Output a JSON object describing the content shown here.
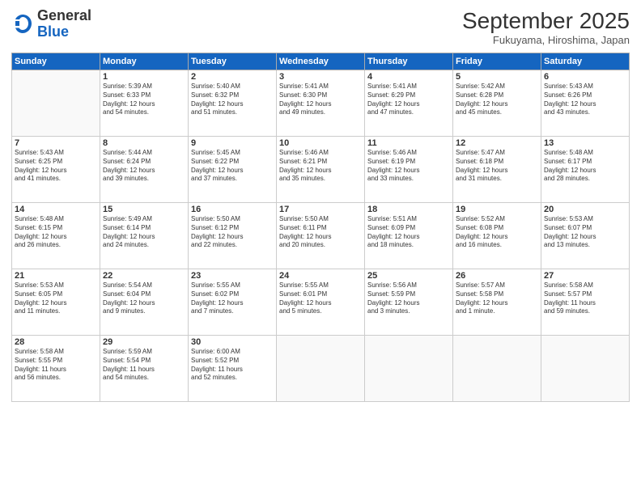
{
  "header": {
    "logo_general": "General",
    "logo_blue": "Blue",
    "month_title": "September 2025",
    "subtitle": "Fukuyama, Hiroshima, Japan"
  },
  "days_of_week": [
    "Sunday",
    "Monday",
    "Tuesday",
    "Wednesday",
    "Thursday",
    "Friday",
    "Saturday"
  ],
  "weeks": [
    [
      {
        "day": "",
        "info": ""
      },
      {
        "day": "1",
        "info": "Sunrise: 5:39 AM\nSunset: 6:33 PM\nDaylight: 12 hours\nand 54 minutes."
      },
      {
        "day": "2",
        "info": "Sunrise: 5:40 AM\nSunset: 6:32 PM\nDaylight: 12 hours\nand 51 minutes."
      },
      {
        "day": "3",
        "info": "Sunrise: 5:41 AM\nSunset: 6:30 PM\nDaylight: 12 hours\nand 49 minutes."
      },
      {
        "day": "4",
        "info": "Sunrise: 5:41 AM\nSunset: 6:29 PM\nDaylight: 12 hours\nand 47 minutes."
      },
      {
        "day": "5",
        "info": "Sunrise: 5:42 AM\nSunset: 6:28 PM\nDaylight: 12 hours\nand 45 minutes."
      },
      {
        "day": "6",
        "info": "Sunrise: 5:43 AM\nSunset: 6:26 PM\nDaylight: 12 hours\nand 43 minutes."
      }
    ],
    [
      {
        "day": "7",
        "info": "Sunrise: 5:43 AM\nSunset: 6:25 PM\nDaylight: 12 hours\nand 41 minutes."
      },
      {
        "day": "8",
        "info": "Sunrise: 5:44 AM\nSunset: 6:24 PM\nDaylight: 12 hours\nand 39 minutes."
      },
      {
        "day": "9",
        "info": "Sunrise: 5:45 AM\nSunset: 6:22 PM\nDaylight: 12 hours\nand 37 minutes."
      },
      {
        "day": "10",
        "info": "Sunrise: 5:46 AM\nSunset: 6:21 PM\nDaylight: 12 hours\nand 35 minutes."
      },
      {
        "day": "11",
        "info": "Sunrise: 5:46 AM\nSunset: 6:19 PM\nDaylight: 12 hours\nand 33 minutes."
      },
      {
        "day": "12",
        "info": "Sunrise: 5:47 AM\nSunset: 6:18 PM\nDaylight: 12 hours\nand 31 minutes."
      },
      {
        "day": "13",
        "info": "Sunrise: 5:48 AM\nSunset: 6:17 PM\nDaylight: 12 hours\nand 28 minutes."
      }
    ],
    [
      {
        "day": "14",
        "info": "Sunrise: 5:48 AM\nSunset: 6:15 PM\nDaylight: 12 hours\nand 26 minutes."
      },
      {
        "day": "15",
        "info": "Sunrise: 5:49 AM\nSunset: 6:14 PM\nDaylight: 12 hours\nand 24 minutes."
      },
      {
        "day": "16",
        "info": "Sunrise: 5:50 AM\nSunset: 6:12 PM\nDaylight: 12 hours\nand 22 minutes."
      },
      {
        "day": "17",
        "info": "Sunrise: 5:50 AM\nSunset: 6:11 PM\nDaylight: 12 hours\nand 20 minutes."
      },
      {
        "day": "18",
        "info": "Sunrise: 5:51 AM\nSunset: 6:09 PM\nDaylight: 12 hours\nand 18 minutes."
      },
      {
        "day": "19",
        "info": "Sunrise: 5:52 AM\nSunset: 6:08 PM\nDaylight: 12 hours\nand 16 minutes."
      },
      {
        "day": "20",
        "info": "Sunrise: 5:53 AM\nSunset: 6:07 PM\nDaylight: 12 hours\nand 13 minutes."
      }
    ],
    [
      {
        "day": "21",
        "info": "Sunrise: 5:53 AM\nSunset: 6:05 PM\nDaylight: 12 hours\nand 11 minutes."
      },
      {
        "day": "22",
        "info": "Sunrise: 5:54 AM\nSunset: 6:04 PM\nDaylight: 12 hours\nand 9 minutes."
      },
      {
        "day": "23",
        "info": "Sunrise: 5:55 AM\nSunset: 6:02 PM\nDaylight: 12 hours\nand 7 minutes."
      },
      {
        "day": "24",
        "info": "Sunrise: 5:55 AM\nSunset: 6:01 PM\nDaylight: 12 hours\nand 5 minutes."
      },
      {
        "day": "25",
        "info": "Sunrise: 5:56 AM\nSunset: 5:59 PM\nDaylight: 12 hours\nand 3 minutes."
      },
      {
        "day": "26",
        "info": "Sunrise: 5:57 AM\nSunset: 5:58 PM\nDaylight: 12 hours\nand 1 minute."
      },
      {
        "day": "27",
        "info": "Sunrise: 5:58 AM\nSunset: 5:57 PM\nDaylight: 11 hours\nand 59 minutes."
      }
    ],
    [
      {
        "day": "28",
        "info": "Sunrise: 5:58 AM\nSunset: 5:55 PM\nDaylight: 11 hours\nand 56 minutes."
      },
      {
        "day": "29",
        "info": "Sunrise: 5:59 AM\nSunset: 5:54 PM\nDaylight: 11 hours\nand 54 minutes."
      },
      {
        "day": "30",
        "info": "Sunrise: 6:00 AM\nSunset: 5:52 PM\nDaylight: 11 hours\nand 52 minutes."
      },
      {
        "day": "",
        "info": ""
      },
      {
        "day": "",
        "info": ""
      },
      {
        "day": "",
        "info": ""
      },
      {
        "day": "",
        "info": ""
      }
    ]
  ]
}
